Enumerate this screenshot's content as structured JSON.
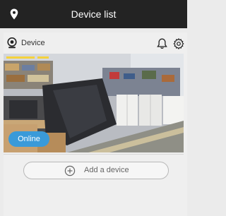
{
  "header": {
    "title": "Device list",
    "location_icon": "location-pin-icon"
  },
  "device": {
    "name": "Device",
    "camera_icon": "camera-icon",
    "notification_icon": "bell-icon",
    "settings_icon": "gear-icon",
    "status": "Online",
    "status_color": "#3a9ad9"
  },
  "actions": {
    "add_device_label": "Add a device",
    "add_icon": "plus-circle-icon"
  }
}
